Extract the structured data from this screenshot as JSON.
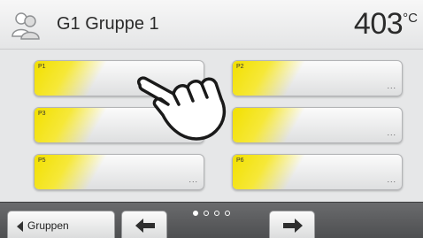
{
  "header": {
    "group_icon": "users-icon",
    "title": "G1 Gruppe 1",
    "temperature": "403",
    "unit": "°C"
  },
  "programs": [
    {
      "label": "P1",
      "more": ""
    },
    {
      "label": "P2",
      "more": "..."
    },
    {
      "label": "P3",
      "more": ""
    },
    {
      "label": "",
      "more": "..."
    },
    {
      "label": "P5",
      "more": "..."
    },
    {
      "label": "P6",
      "more": "..."
    }
  ],
  "footer": {
    "back_label": "Gruppen",
    "back_icon": "triangle-left-icon",
    "prev_icon": "arrow-left-icon",
    "next_icon": "arrow-right-icon",
    "pages": 4,
    "current_page": 1
  },
  "overlay": {
    "icon": "pointing-hand-icon"
  },
  "colors": {
    "accent_yellow": "#f2e000",
    "footer": "#58595b",
    "background": "#e6e7e8"
  }
}
